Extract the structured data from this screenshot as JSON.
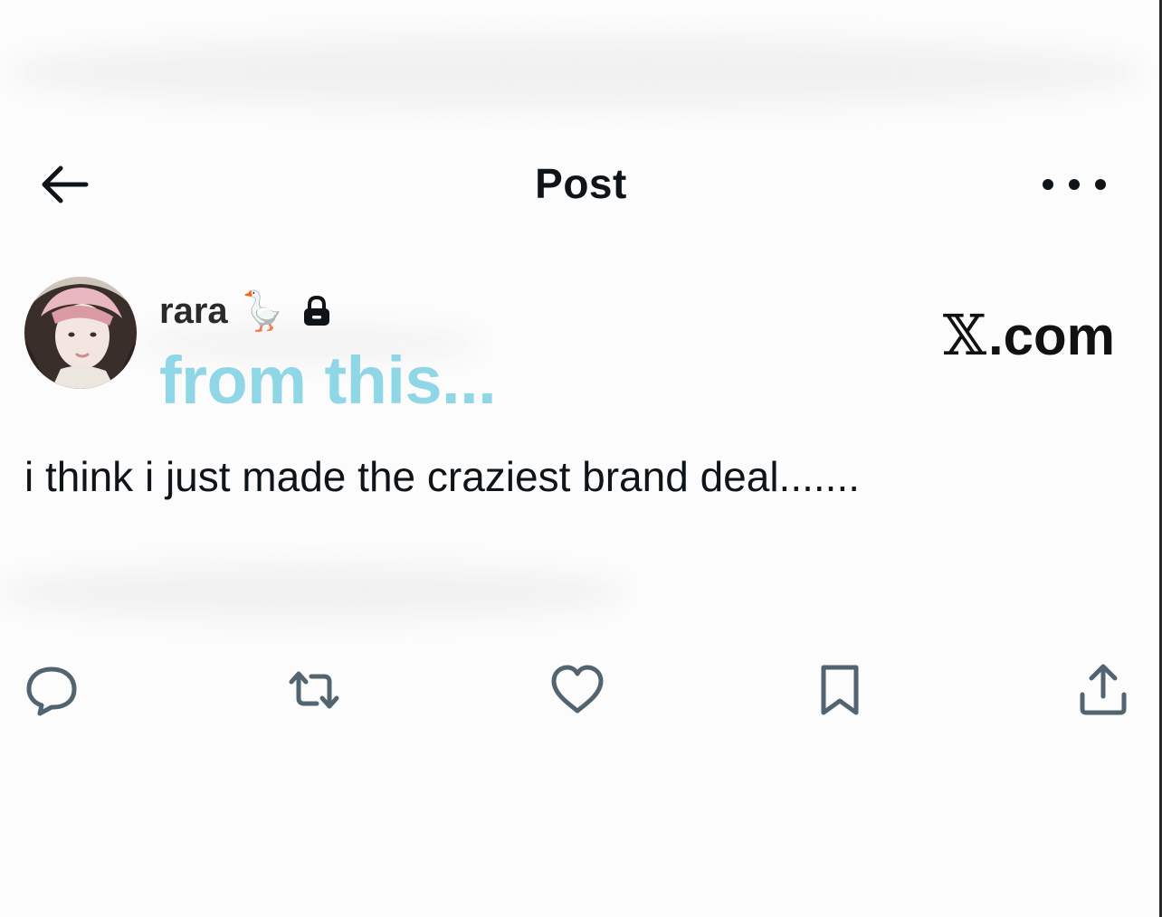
{
  "header": {
    "title": "Post"
  },
  "author": {
    "name": "rara",
    "emoji": "🪿"
  },
  "overlay": {
    "text": "from this..."
  },
  "watermark": {
    "text": ".com"
  },
  "post": {
    "text": "i think i just made the craziest brand deal......."
  },
  "icons": {
    "back": "back-arrow-icon",
    "more": "more-horizontal-icon",
    "lock": "lock-icon",
    "reply": "reply-icon",
    "repost": "repost-icon",
    "like": "heart-icon",
    "bookmark": "bookmark-icon",
    "share": "share-icon"
  },
  "colors": {
    "overlay": "#8fd6e6",
    "icon": "#536471",
    "text": "#0f1419"
  }
}
